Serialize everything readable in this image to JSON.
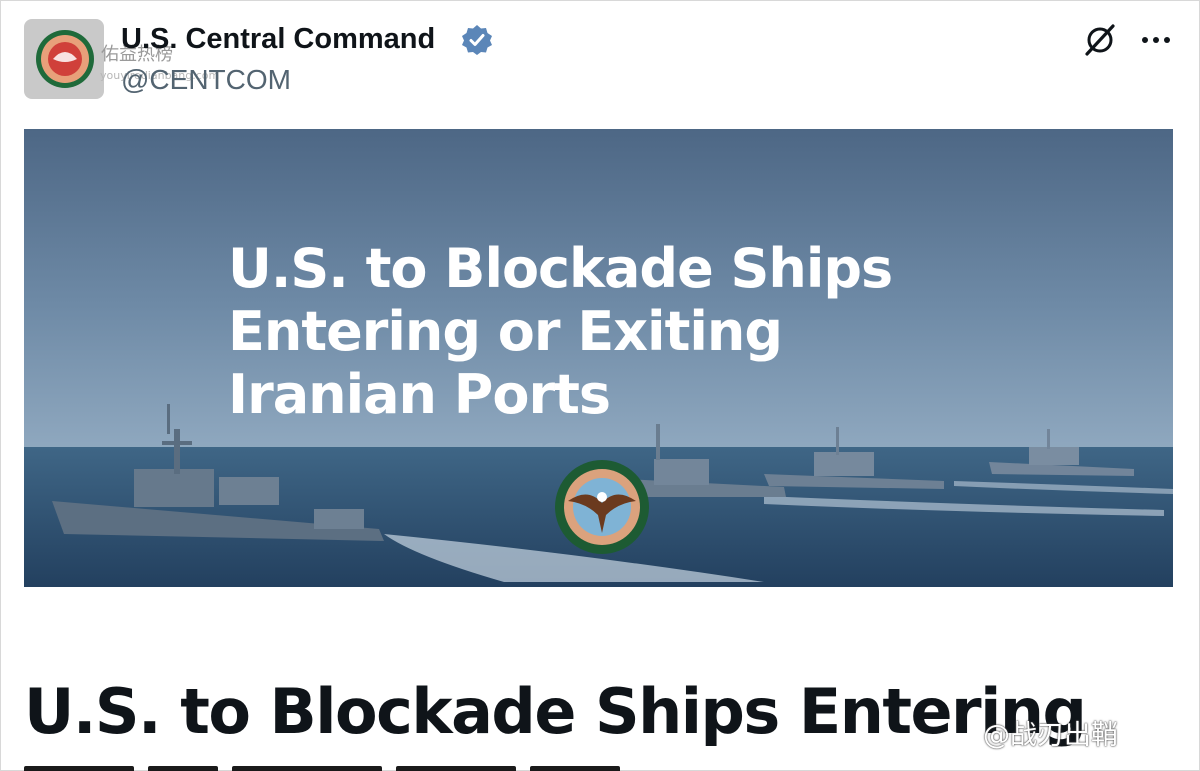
{
  "post": {
    "display_name": "U.S. Central Command",
    "handle": "@CENTCOM",
    "verified_icon": "verified-badge-icon",
    "grok_icon": "grok-icon",
    "more_icon": "more-options-icon"
  },
  "banner": {
    "title": "U.S. to Blockade Ships Entering or Exiting Iranian Ports",
    "seal_icon": "centcom-seal-icon"
  },
  "headline": "U.S. to Blockade Ships Entering",
  "watermarks": {
    "top_cn": "佑益热榜",
    "top_url": "youyiredianbang.com",
    "bottom_cn": "@战刃出鞘"
  },
  "colors": {
    "verified": "#5b86b8",
    "name_text": "#0f1419",
    "handle_text": "#536471",
    "sky": "#5f7a98",
    "sea": "#2c4d6f"
  }
}
